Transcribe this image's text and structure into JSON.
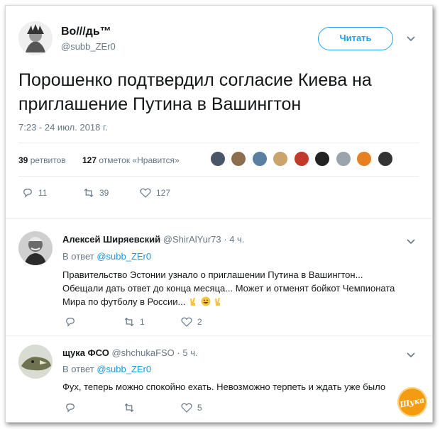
{
  "main_tweet": {
    "display_name": "Во///дь™",
    "handle": "@subb_ZEr0",
    "follow_label": "Читать",
    "text": "Порошенко подтвердил согласие Киева на приглашение Путина в Вашингтон",
    "timestamp": "7:23 - 24 июл. 2018 г.",
    "retweets_count": "39",
    "retweets_label": "ретвитов",
    "likes_count": "127",
    "likes_label": "отметок «Нравится»",
    "actions": {
      "replies": "11",
      "retweets": "39",
      "likes": "127"
    }
  },
  "replies": [
    {
      "display_name": "Алексей Ширяевский",
      "handle": "@ShirAlYur73",
      "time": "· 4 ч.",
      "reply_prefix": "В ответ",
      "reply_to": "@subb_ZEr0",
      "text_line1": "Правительство Эстонии узнало о приглашении Путина в Вашингтон...",
      "text_line2": "Обещали дать ответ до конца месяца... Может и отменят бойкот Чемпионата",
      "text_line3": "Мира по футболу в России...",
      "actions": {
        "replies": "",
        "retweets": "1",
        "likes": "2"
      }
    },
    {
      "display_name": "щука ФСО",
      "handle": "@shchukaFSO",
      "time": "· 5 ч.",
      "reply_prefix": "В ответ",
      "reply_to": "@subb_ZEr0",
      "text_line1": "Фух, теперь можно спокойно ехать. Невозможно терпеть и ждать уже было",
      "actions": {
        "replies": "",
        "retweets": "",
        "likes": "5"
      }
    }
  ],
  "watermark": "Щука",
  "colors": {
    "accent": "#1da1f2",
    "link": "#1b95e0",
    "text": "#14171a",
    "muted": "#657786",
    "divider": "#e6ecf0"
  }
}
